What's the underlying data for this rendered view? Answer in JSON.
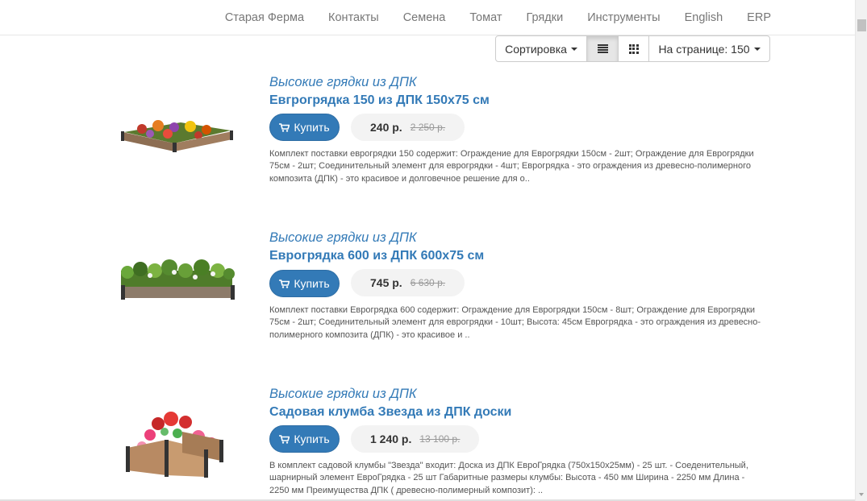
{
  "nav": {
    "items": [
      "Старая Ферма",
      "Контакты",
      "Семена",
      "Томат",
      "Грядки",
      "Инструменты",
      "English",
      "ERP"
    ]
  },
  "toolbar": {
    "sort_label": "Сортировка",
    "list_icon": "list-view-icon",
    "grid_icon": "grid-view-icon",
    "per_page_label": "На странице: 150"
  },
  "colors": {
    "link": "#337ab7",
    "button": "#337ab7",
    "price_bg": "#f3f3f3"
  },
  "products": [
    {
      "category": "Высокие грядки из ДПК",
      "title": "Евгрогрядка 150 из ДПК 150х75 см",
      "buy_label": "Купить",
      "price": "240 р.",
      "old_price": "2 250 р.",
      "description": "Комплект поставки еврогрядки 150 содержит: Ограждение для Еврогрядки 150см - 2шт; Ограждение для Еврогрядки 75см - 2шт; Соединительный элемент для еврогрядки - 4шт; Еврогрядка - это ограждения из древесно-полимерного композита (ДПК) - это красивое и долговечное решение для о.."
    },
    {
      "category": "Высокие грядки из ДПК",
      "title": "Еврогрядка 600 из ДПК 600х75 см",
      "buy_label": "Купить",
      "price": "745 р.",
      "old_price": "6 630 р.",
      "description": "Комплект поставки Еврогрядка 600 содержит: Ограждение для Еврогрядки 150см - 8шт; Ограждение для Еврогрядки 75см - 2шт; Соединительный элемент для еврогрядки - 10шт; Высота: 45см Еврогрядка - это ограждения из древесно-полимерного композита (ДПК) - это красивое и .."
    },
    {
      "category": "Высокие грядки из ДПК",
      "title": "Садовая клумба Звезда из ДПК доски",
      "buy_label": "Купить",
      "price": "1 240 р.",
      "old_price": "13 100 р.",
      "description": "В комплект садовой клумбы \"Звезда\" входит: Доска из ДПК ЕвроГрядка (750x150x25мм) - 25 шт. - Соеденительный, шарнирный элемент ЕвроГрядка - 25 шт Габаритные размеры клумбы: Высота - 450 мм Ширина - 2250 мм Длина - 2250 мм Преимущества ДПК ( древесно-полимерный композит): .."
    }
  ]
}
